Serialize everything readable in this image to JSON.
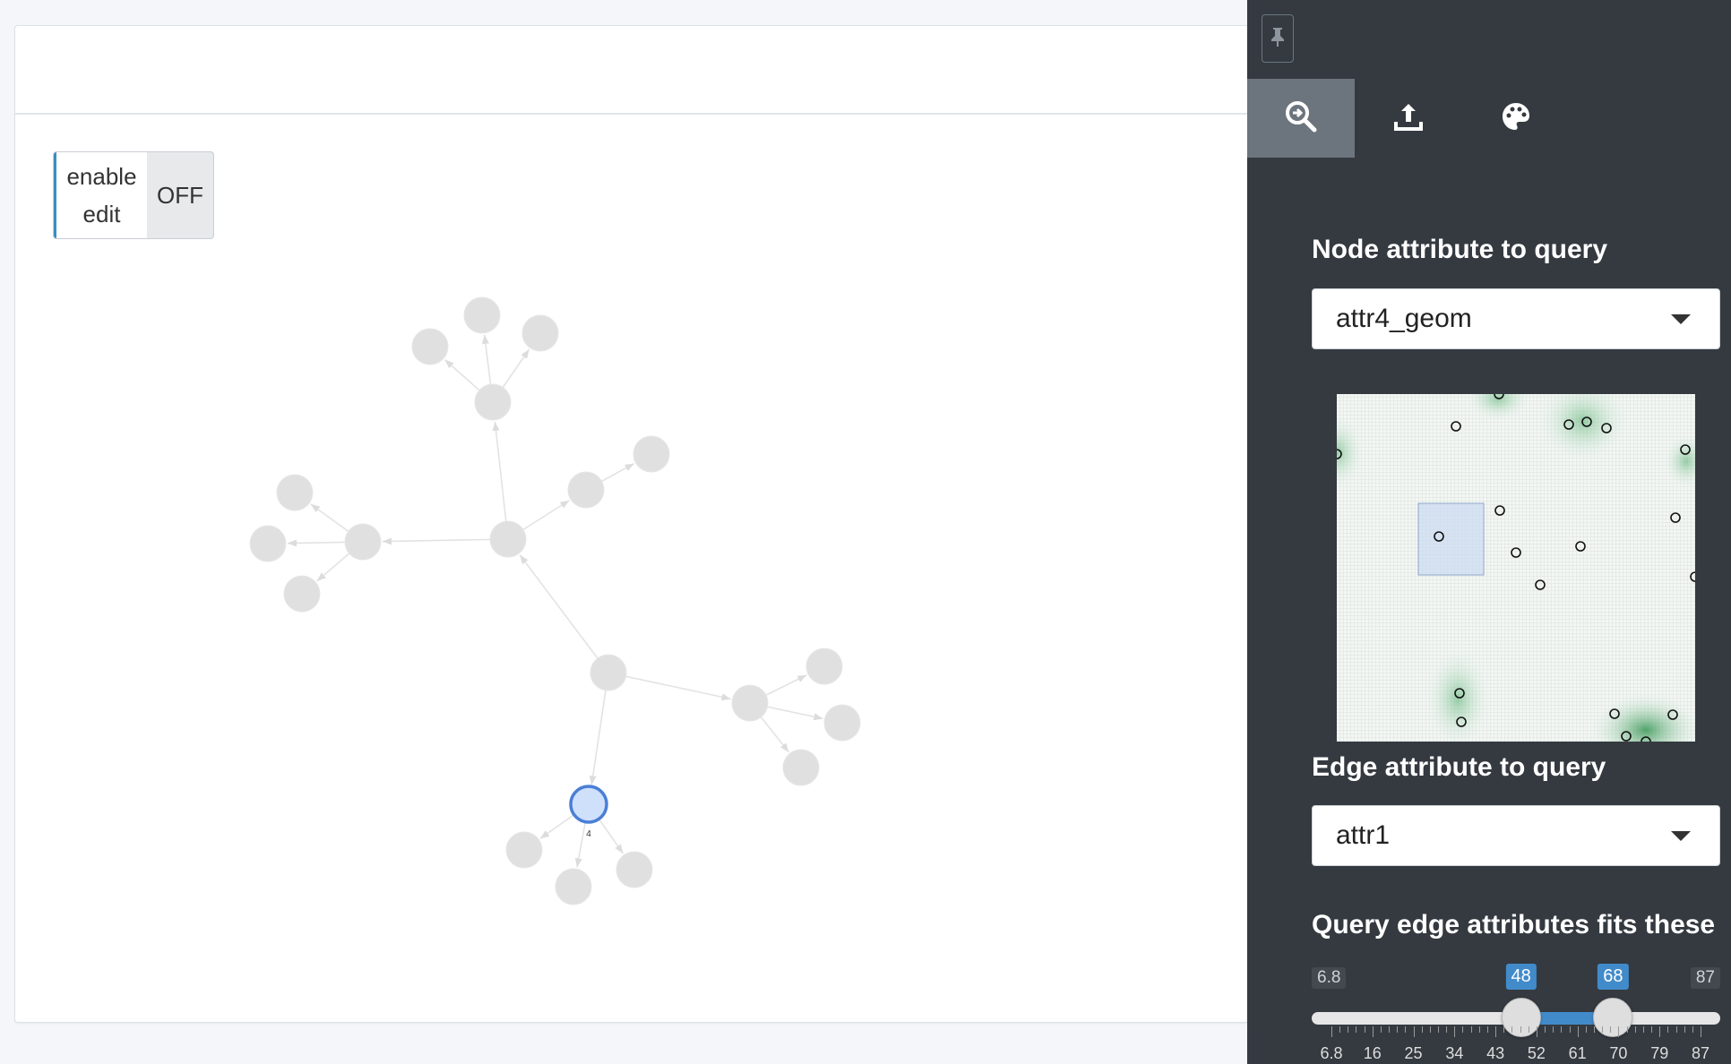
{
  "toggle": {
    "label": "enable edit",
    "state": "OFF"
  },
  "graph": {
    "selected_node_label": "4",
    "node_color": "#e0e0e0",
    "edge_color": "#e3e3e3",
    "selected_fill": "#cfe0fb",
    "selected_stroke": "#4a7fd6"
  },
  "sidebar": {
    "tabs": [
      {
        "icon": "search-icon",
        "active": true
      },
      {
        "icon": "upload-icon",
        "active": false
      },
      {
        "icon": "palette-icon",
        "active": false
      }
    ],
    "node_attr_label": "Node attribute to query",
    "node_attr_value": "attr4_geom",
    "edge_attr_label": "Edge attribute to query",
    "edge_attr_value": "attr1",
    "range_label": "Query edge attributes fits these",
    "slider": {
      "min": 6.8,
      "max": 87,
      "low": 48,
      "high": 68,
      "min_label": "6.8",
      "max_label": "87",
      "low_label": "48",
      "high_label": "68",
      "ticks": [
        "6.8",
        "16",
        "25",
        "34",
        "43",
        "52",
        "61",
        "70",
        "79",
        "87"
      ]
    }
  },
  "colors": {
    "sidebar_bg": "#343a40",
    "accent": "#428bca"
  }
}
